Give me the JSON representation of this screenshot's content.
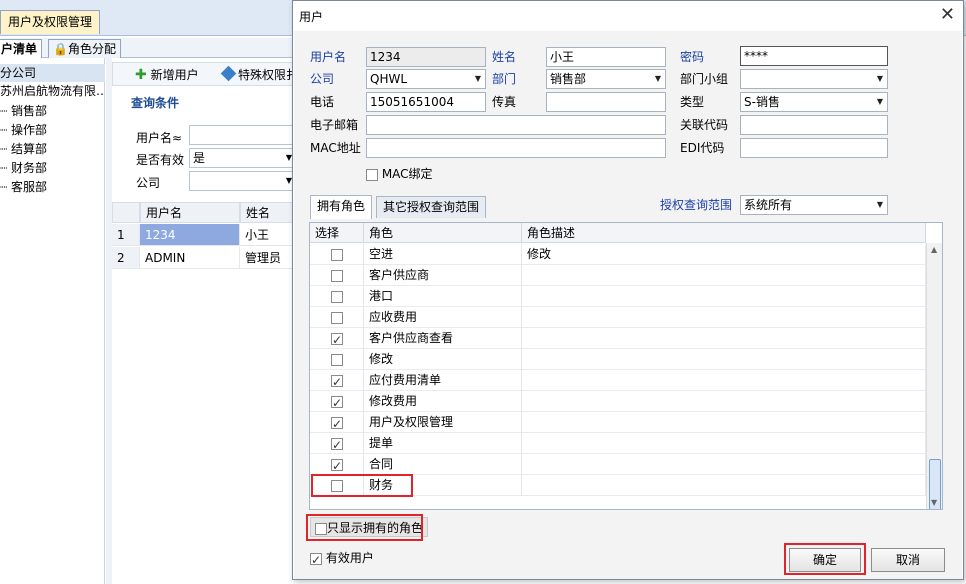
{
  "app": {
    "doc_tab": "用户及权限管理",
    "sub_tabs": [
      "户清单",
      "角色分配"
    ],
    "tree": [
      "分公司",
      "苏州启航物流有限…",
      "销售部",
      "操作部",
      "结算部",
      "财务部",
      "客服部"
    ],
    "toolbar": {
      "add_user": "新增用户",
      "special": "特殊权限扌"
    },
    "query": {
      "title": "查询条件",
      "username_label": "用户名≈",
      "active_label": "是否有效",
      "active_value": "是",
      "company_label": "公司"
    },
    "grid": {
      "headers": [
        "用户名",
        "姓名"
      ],
      "rows": [
        {
          "no": "1",
          "username": "1234",
          "name": "小王"
        },
        {
          "no": "2",
          "username": "ADMIN",
          "name": "管理员"
        }
      ]
    }
  },
  "dialog": {
    "title": "用户",
    "fields": {
      "username_label": "用户名",
      "username": "1234",
      "name_label": "姓名",
      "name": "小王",
      "password_label": "密码",
      "password": "****",
      "company_label": "公司",
      "company": "QHWL",
      "dept_label": "部门",
      "dept": "销售部",
      "group_label": "部门小组",
      "group": "",
      "phone_label": "电话",
      "phone": "15051651004",
      "fax_label": "传真",
      "fax": "",
      "type_label": "类型",
      "type": "S-销售",
      "email_label": "电子邮箱",
      "email": "",
      "relcode_label": "关联代码",
      "relcode": "",
      "mac_label": "MAC地址",
      "mac": "",
      "edi_label": "EDI代码",
      "edi": "",
      "mac_bind_label": "MAC绑定"
    },
    "tabs": [
      "拥有角色",
      "其它授权查询范围"
    ],
    "scope_label": "授权查询范围",
    "scope_value": "系统所有",
    "role_grid": {
      "headers": [
        "选择",
        "角色",
        "角色描述"
      ],
      "rows": [
        {
          "checked": false,
          "role": "空进",
          "desc": "修改"
        },
        {
          "checked": false,
          "role": "客户供应商",
          "desc": ""
        },
        {
          "checked": false,
          "role": "港口",
          "desc": ""
        },
        {
          "checked": false,
          "role": "应收费用",
          "desc": ""
        },
        {
          "checked": true,
          "role": "客户供应商查看",
          "desc": ""
        },
        {
          "checked": false,
          "role": "修改",
          "desc": ""
        },
        {
          "checked": true,
          "role": "应付费用清单",
          "desc": ""
        },
        {
          "checked": true,
          "role": "修改费用",
          "desc": ""
        },
        {
          "checked": true,
          "role": "用户及权限管理",
          "desc": ""
        },
        {
          "checked": true,
          "role": "提单",
          "desc": ""
        },
        {
          "checked": true,
          "role": "合同",
          "desc": ""
        },
        {
          "checked": false,
          "role": "财务",
          "desc": ""
        }
      ]
    },
    "only_owned_label": "只显示拥有的角色",
    "active_user_label": "有效用户",
    "ok_label": "确定",
    "cancel_label": "取消"
  }
}
